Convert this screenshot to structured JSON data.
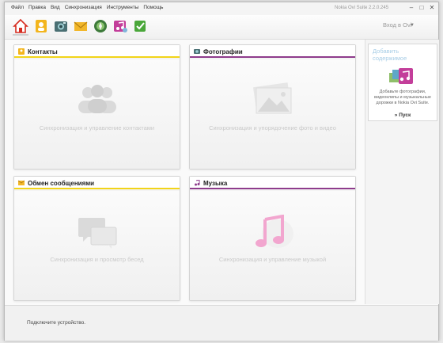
{
  "menu": [
    "Файл",
    "Правка",
    "Вид",
    "Синхронизация",
    "Инструменты",
    "Помощь"
  ],
  "window": {
    "title": "Nokia Ovi Suite 2.2.0.245",
    "minimize": "–",
    "maximize": "□",
    "close": "✕"
  },
  "toolbar": {
    "buttons": [
      "home-icon",
      "contacts-icon",
      "photos-icon",
      "messages-icon",
      "maps-icon",
      "music-icon",
      "sync-check-icon"
    ],
    "login_label": "Вход в Ovi",
    "dropdown_glyph": "▼"
  },
  "cards": {
    "contacts": {
      "title": "Контакты",
      "caption": "Синхронизация и управление контактами",
      "accent": "#f2d41a"
    },
    "photos": {
      "title": "Фотографии",
      "caption": "Синхронизация и упорядочение фото и видео",
      "accent": "#8e3c8c"
    },
    "messages": {
      "title": "Обмен сообщениями",
      "caption": "Синхронизация и просмотр бесед",
      "accent": "#f2d41a"
    },
    "music": {
      "title": "Музыка",
      "caption": "Синхронизация и управление музыкой",
      "accent": "#8e3c8c"
    }
  },
  "add_content": {
    "title_line1": "Добавить",
    "title_line2": "содержимое",
    "desc_line1": "Добавьте фотографии,",
    "desc_line2": "видеоклипы и музыкальные",
    "desc_line3": "дорожки в Nokia Ovi Suite.",
    "start_label": "» Пуск"
  },
  "status": {
    "text": "Подключите устройство."
  }
}
